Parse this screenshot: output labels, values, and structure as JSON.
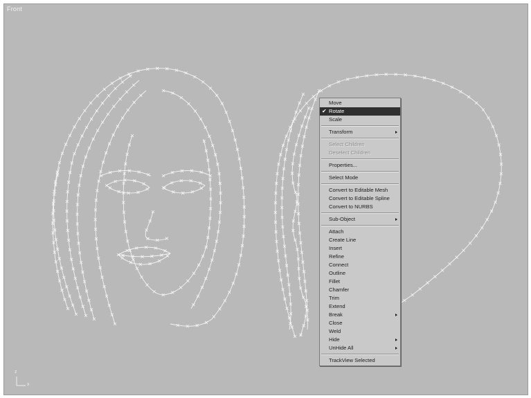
{
  "viewport": {
    "label": "Front",
    "axis_z": "z",
    "axis_x": "x"
  },
  "menu": {
    "groups": [
      [
        {
          "label": "Move"
        },
        {
          "label": "Rotate",
          "checked": true,
          "active": true
        },
        {
          "label": "Scale"
        }
      ],
      [
        {
          "label": "Transform",
          "submenu": true
        }
      ],
      [
        {
          "label": "Select Children",
          "disabled": true
        },
        {
          "label": "Deselect Children",
          "disabled": true
        }
      ],
      [
        {
          "label": "Properties..."
        }
      ],
      [
        {
          "label": "Select Mode"
        }
      ],
      [
        {
          "label": "Convert to Editable Mesh"
        },
        {
          "label": "Convert to Editable Spline"
        },
        {
          "label": "Convert to NURBS"
        }
      ],
      [
        {
          "label": "Sub-Object",
          "submenu": true
        }
      ],
      [
        {
          "label": "Attach"
        },
        {
          "label": "Create Line"
        },
        {
          "label": "Insert"
        },
        {
          "label": "Refine"
        },
        {
          "label": "Connect"
        },
        {
          "label": "Outline"
        },
        {
          "label": "Fillet"
        },
        {
          "label": "Chamfer"
        },
        {
          "label": "Trim"
        },
        {
          "label": "Extend"
        },
        {
          "label": "Break",
          "submenu": true
        },
        {
          "label": "Close"
        },
        {
          "label": "Weld"
        },
        {
          "label": "Hide",
          "submenu": true
        },
        {
          "label": "UnHide All",
          "submenu": true
        }
      ],
      [
        {
          "label": "TrackView Selected"
        }
      ]
    ]
  }
}
